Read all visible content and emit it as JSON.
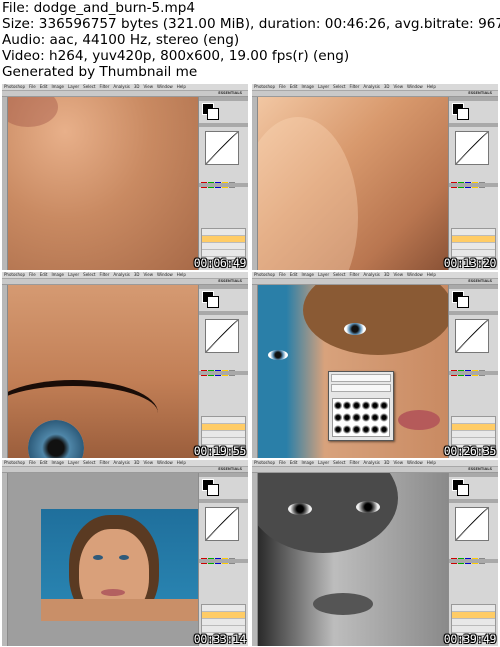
{
  "header": {
    "file": "File: dodge_and_burn-5.mp4",
    "size": "Size: 336596757 bytes (321.00 MiB), duration: 00:46:26, avg.bitrate: 967 kb/s",
    "audio": "Audio: aac, 44100 Hz, stereo (eng)",
    "video": "Video: h264, yuv420p, 800x600, 19.00 fps(r) (eng)",
    "generator": "Generated by Thumbnail me"
  },
  "app": {
    "menu": [
      "Photoshop",
      "File",
      "Edit",
      "Image",
      "Layer",
      "Select",
      "Filter",
      "Analysis",
      "3D",
      "View",
      "Window",
      "Help"
    ],
    "workspace": "ESSENTIALS"
  },
  "thumbnails": [
    {
      "timestamp": "00:06:49",
      "content": "skin-closeup"
    },
    {
      "timestamp": "00:13:20",
      "content": "neck-closeup"
    },
    {
      "timestamp": "00:19:55",
      "content": "eye-lashes-closeup"
    },
    {
      "timestamp": "00:26:35",
      "content": "face-brush-picker"
    },
    {
      "timestamp": "00:33:14",
      "content": "full-portrait-blue"
    },
    {
      "timestamp": "00:39:49",
      "content": "bw-portrait"
    }
  ],
  "colors": {
    "skin": "#c8926a",
    "background_blue": "#2a7fa8",
    "panel": "#d6d6d6",
    "layer_selected": "#ffcc66"
  }
}
